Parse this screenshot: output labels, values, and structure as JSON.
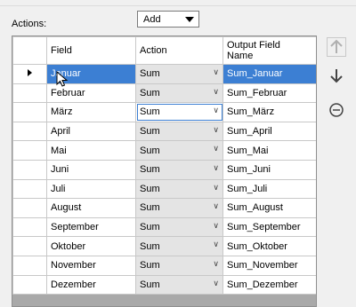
{
  "actions_label": "Actions:",
  "add_select": {
    "value": "Add"
  },
  "columns": {
    "field": "Field",
    "action": "Action",
    "output_line1": "Output Field",
    "output_line2": "Name"
  },
  "rows": [
    {
      "field": "Januar",
      "action": "Sum",
      "output": "Sum_Januar"
    },
    {
      "field": "Februar",
      "action": "Sum",
      "output": "Sum_Februar"
    },
    {
      "field": "März",
      "action": "Sum",
      "output": "Sum_März"
    },
    {
      "field": "April",
      "action": "Sum",
      "output": "Sum_April"
    },
    {
      "field": "Mai",
      "action": "Sum",
      "output": "Sum_Mai"
    },
    {
      "field": "Juni",
      "action": "Sum",
      "output": "Sum_Juni"
    },
    {
      "field": "Juli",
      "action": "Sum",
      "output": "Sum_Juli"
    },
    {
      "field": "August",
      "action": "Sum",
      "output": "Sum_August"
    },
    {
      "field": "September",
      "action": "Sum",
      "output": "Sum_September"
    },
    {
      "field": "Oktober",
      "action": "Sum",
      "output": "Sum_Oktober"
    },
    {
      "field": "November",
      "action": "Sum",
      "output": "Sum_November"
    },
    {
      "field": "Dezember",
      "action": "Sum",
      "output": "Sum_Dezember"
    }
  ],
  "side_buttons": {
    "up_icon": "arrow-up-icon",
    "down_icon": "arrow-down-icon",
    "remove_icon": "remove-circle-icon"
  },
  "colors": {
    "selection": "#3c7fd3",
    "action_cell": "#e4e4e4"
  }
}
